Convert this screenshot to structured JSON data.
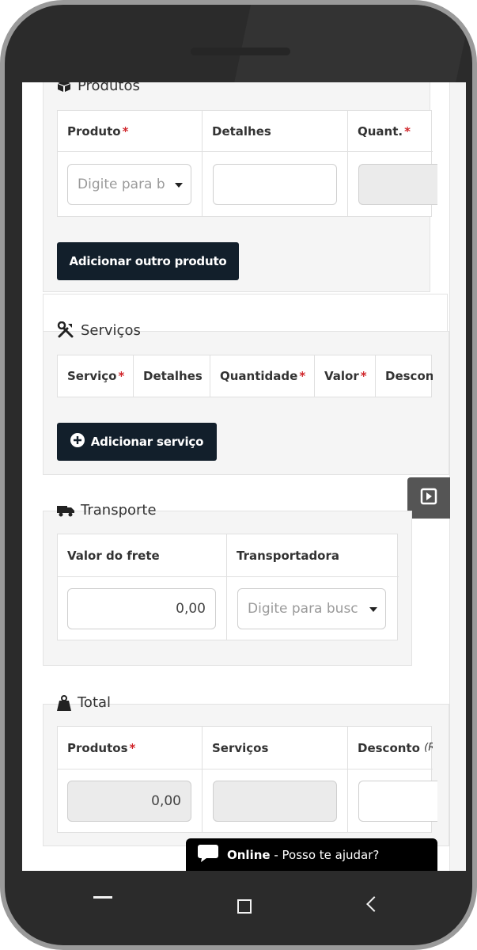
{
  "produtos": {
    "title": "Produtos",
    "columns": {
      "produto": "Produto",
      "detalhes": "Detalhes",
      "quant": "Quant."
    },
    "required_mark": "*",
    "produto_placeholder": "Digite para b",
    "add_button": "Adicionar outro produto"
  },
  "servicos": {
    "title": "Serviços",
    "columns": {
      "servico": "Serviço",
      "detalhes": "Detalhes",
      "quantidade": "Quantidade",
      "valor": "Valor",
      "desconto": "Descon"
    },
    "add_button": "Adicionar serviço"
  },
  "transporte": {
    "title": "Transporte",
    "columns": {
      "frete": "Valor do frete",
      "transportadora": "Transportadora"
    },
    "frete_value": "0,00",
    "transportadora_placeholder": "Digite para busc"
  },
  "total": {
    "title": "Total",
    "columns": {
      "produtos": "Produtos",
      "servicos": "Serviços",
      "desconto": "Desconto",
      "desconto_unit": "(R"
    },
    "produtos_value": "0,00"
  },
  "chat": {
    "status": "Online",
    "separator": " - ",
    "message": "Posso te ajudar?"
  },
  "colors": {
    "button_bg": "#121f2b",
    "required": "#d0262b",
    "chat_bg": "#000000"
  },
  "icons": {
    "produtos": "box-icon",
    "servicos": "tools-icon",
    "transporte": "truck-icon",
    "total": "weight-icon",
    "add": "plus-circle-icon",
    "video": "play-square-icon",
    "chat": "speech-bubble-icon"
  }
}
